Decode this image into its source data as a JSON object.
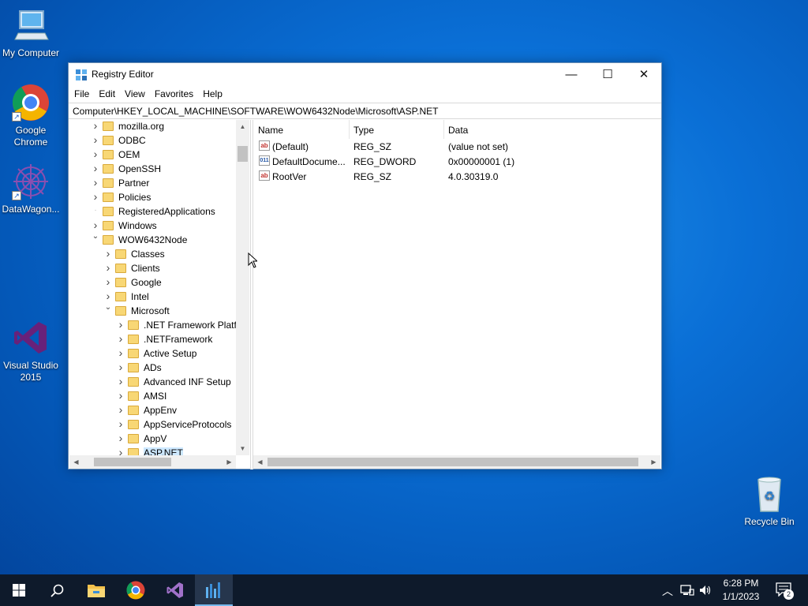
{
  "desktop": {
    "icons": [
      {
        "label": "My Computer"
      },
      {
        "label": "Google Chrome"
      },
      {
        "label": "DataWagon..."
      },
      {
        "label": "Visual Studio 2015"
      },
      {
        "label": "Recycle Bin"
      }
    ]
  },
  "window": {
    "title": "Registry Editor",
    "controls": {
      "minimize": "—",
      "maximize": "☐",
      "close": "✕"
    },
    "menu": [
      "File",
      "Edit",
      "View",
      "Favorites",
      "Help"
    ],
    "address": "Computer\\HKEY_LOCAL_MACHINE\\SOFTWARE\\WOW6432Node\\Microsoft\\ASP.NET",
    "tree": [
      {
        "label": "mozilla.org",
        "level": 1,
        "state": "collapsed"
      },
      {
        "label": "ODBC",
        "level": 1,
        "state": "collapsed"
      },
      {
        "label": "OEM",
        "level": 1,
        "state": "collapsed"
      },
      {
        "label": "OpenSSH",
        "level": 1,
        "state": "collapsed"
      },
      {
        "label": "Partner",
        "level": 1,
        "state": "collapsed"
      },
      {
        "label": "Policies",
        "level": 1,
        "state": "collapsed"
      },
      {
        "label": "RegisteredApplications",
        "level": 1,
        "state": "leaf"
      },
      {
        "label": "Windows",
        "level": 1,
        "state": "collapsed"
      },
      {
        "label": "WOW6432Node",
        "level": 1,
        "state": "expanded"
      },
      {
        "label": "Classes",
        "level": 2,
        "state": "collapsed"
      },
      {
        "label": "Clients",
        "level": 2,
        "state": "collapsed"
      },
      {
        "label": "Google",
        "level": 2,
        "state": "collapsed"
      },
      {
        "label": "Intel",
        "level": 2,
        "state": "collapsed"
      },
      {
        "label": "Microsoft",
        "level": 2,
        "state": "expanded"
      },
      {
        "label": ".NET Framework Platfo",
        "level": 3,
        "state": "collapsed"
      },
      {
        "label": ".NETFramework",
        "level": 3,
        "state": "collapsed"
      },
      {
        "label": "Active Setup",
        "level": 3,
        "state": "collapsed"
      },
      {
        "label": "ADs",
        "level": 3,
        "state": "collapsed"
      },
      {
        "label": "Advanced INF Setup",
        "level": 3,
        "state": "collapsed"
      },
      {
        "label": "AMSI",
        "level": 3,
        "state": "collapsed"
      },
      {
        "label": "AppEnv",
        "level": 3,
        "state": "collapsed"
      },
      {
        "label": "AppServiceProtocols",
        "level": 3,
        "state": "collapsed"
      },
      {
        "label": "AppV",
        "level": 3,
        "state": "collapsed"
      },
      {
        "label": "ASP.NET",
        "level": 3,
        "state": "selected"
      }
    ],
    "columns": {
      "name": "Name",
      "type": "Type",
      "data": "Data"
    },
    "values": [
      {
        "name": "(Default)",
        "type": "REG_SZ",
        "data": "(value not set)",
        "icon": "string-value-icon"
      },
      {
        "name": "DefaultDocume...",
        "type": "REG_DWORD",
        "data": "0x00000001 (1)",
        "icon": "dword-value-icon"
      },
      {
        "name": "RootVer",
        "type": "REG_SZ",
        "data": "4.0.30319.0",
        "icon": "string-value-icon"
      }
    ]
  },
  "taskbar": {
    "clock_time": "6:28 PM",
    "clock_date": "1/1/2023",
    "notification_count": "2"
  },
  "colors": {
    "desktop_blue": "#0a6fd6",
    "taskbar": "#0e1a2b",
    "folder_yellow": "#f8d775",
    "selection": "#cde8ff"
  }
}
